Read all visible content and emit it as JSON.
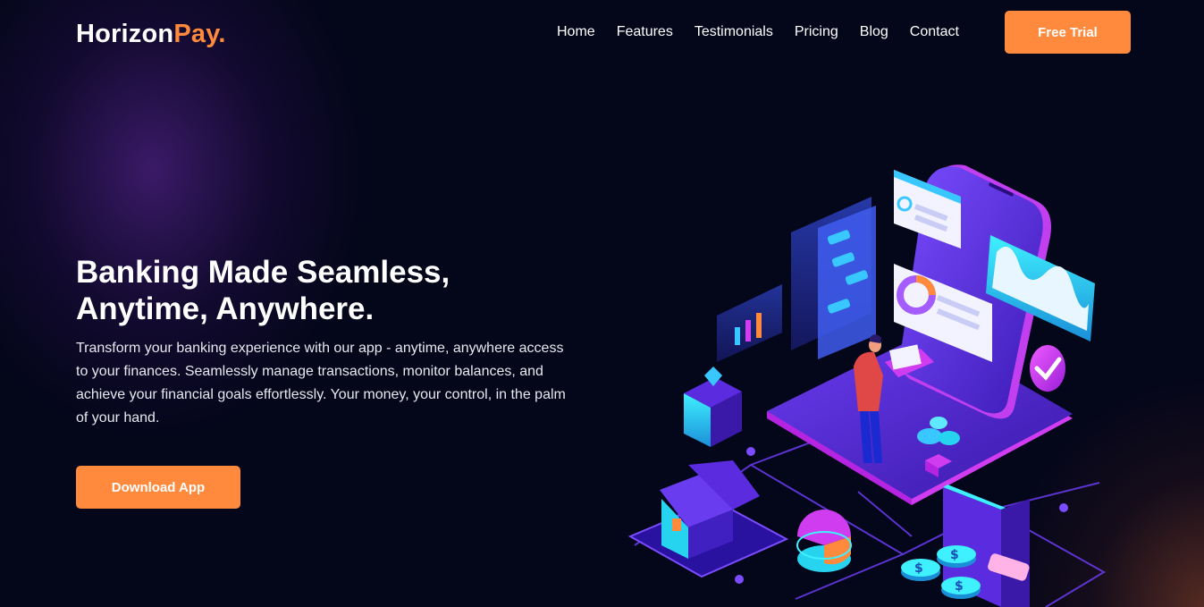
{
  "header": {
    "logo_main": "Horizon",
    "logo_accent": "Pay.",
    "nav": [
      "Home",
      "Features",
      "Testimonials",
      "Pricing",
      "Blog",
      "Contact"
    ],
    "cta_label": "Free Trial"
  },
  "hero": {
    "title_line1": "Banking Made Seamless,",
    "title_line2": "Anytime, Anywhere.",
    "description": "Transform your banking experience with our app - anytime, anywhere access to your finances. Seamlessly manage transactions, monitor balances, and achieve your financial goals effortlessly. Your money, your control, in the palm of your hand.",
    "button_label": "Download App"
  },
  "colors": {
    "background": "#04061a",
    "accent": "#ff8a3d",
    "illustration_primary": "#5b2be0",
    "illustration_cyan": "#27d4f0",
    "illustration_magenta": "#d03cf0"
  },
  "icons": [
    "mobile-banking-illustration",
    "phone-icon",
    "checkmark-badge-icon",
    "house-icon",
    "coin-stack-icon",
    "wallet-icon",
    "pie-chart-icon",
    "bar-chart-panel-icon",
    "plant-icon",
    "person-icon"
  ]
}
